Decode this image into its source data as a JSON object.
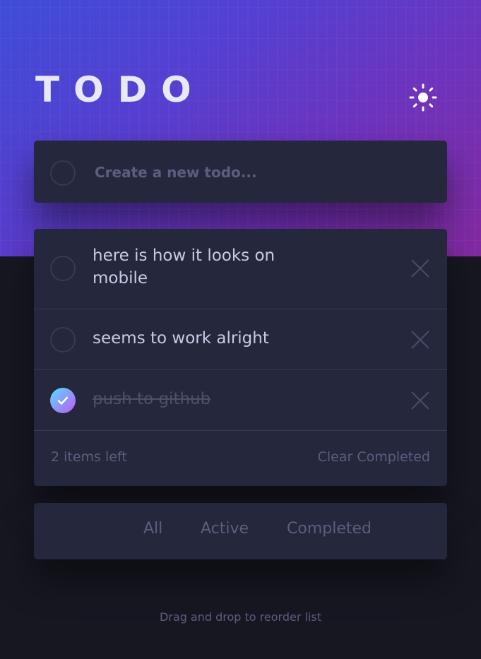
{
  "header": {
    "title": "TODO",
    "theme_icon": "sun-icon"
  },
  "new_todo": {
    "placeholder": "Create a new todo..."
  },
  "todos": [
    {
      "text": "here is how it looks on mobile",
      "completed": false
    },
    {
      "text": "seems to work alright",
      "completed": false
    },
    {
      "text": "push to github",
      "completed": true
    }
  ],
  "footer": {
    "items_left": "2 items left",
    "clear_label": "Clear Completed"
  },
  "filters": {
    "all": "All",
    "active": "Active",
    "completed": "Completed"
  },
  "hint": "Drag and drop to reorder list",
  "colors": {
    "card": "#25273c",
    "background": "#171722",
    "text": "#c8cbe7",
    "muted": "#5b5e7e",
    "check_gradient_start": "#57ddff",
    "check_gradient_end": "#c058f3"
  }
}
